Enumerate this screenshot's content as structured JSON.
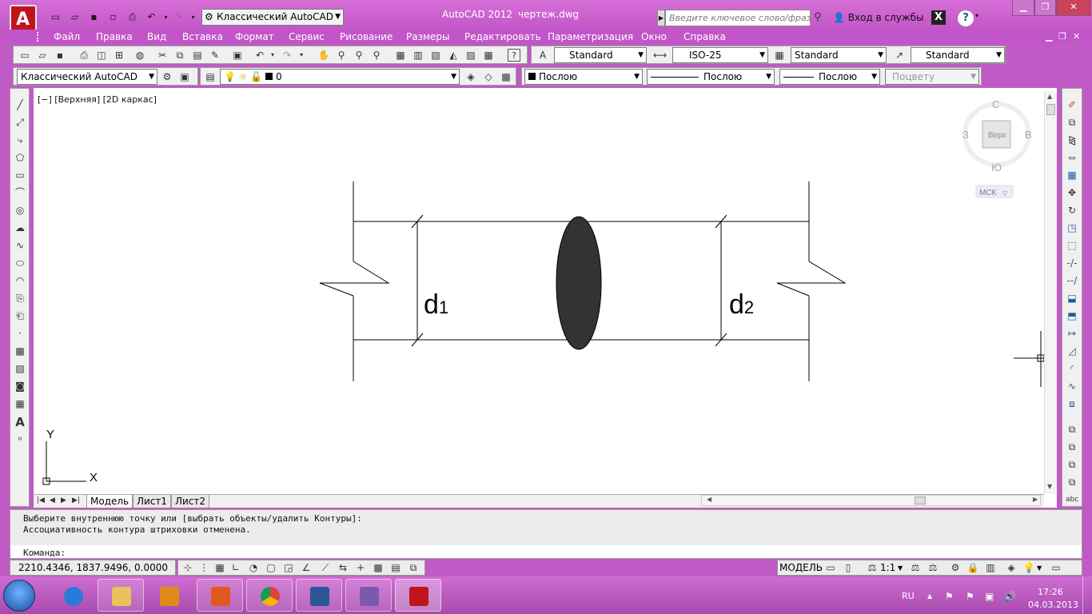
{
  "title_bar": {
    "workspace": "Классический AutoCAD",
    "app_name": "AutoCAD 2012",
    "document": "чертеж.dwg",
    "search_placeholder": "Введите ключевое слово/фразу",
    "sign_in": "Вход в службы"
  },
  "menu": [
    "Файл",
    "Правка",
    "Вид",
    "Вставка",
    "Формат",
    "Сервис",
    "Рисование",
    "Размеры",
    "Редактировать",
    "Параметризация",
    "Окно",
    "Справка"
  ],
  "styles_toolbar": {
    "text_style": "Standard",
    "dim_style": "ISO-25",
    "table_style": "Standard",
    "multileader_style": "Standard"
  },
  "properties_toolbar": {
    "workspace": "Классический AutoCAD",
    "layer": "0",
    "color": "Послою",
    "linetype": "Послою",
    "lineweight": "Послою",
    "plotstyle": "Поцвету"
  },
  "viewport": {
    "label": "[−] [Верхняя] [2D каркас]",
    "viewcube": {
      "north": "С",
      "south": "Ю",
      "west": "З",
      "east": "В",
      "face": "Верх",
      "ucs": "МСК"
    },
    "ucs_x": "X",
    "ucs_y": "Y"
  },
  "drawing": {
    "label_left_base": "d",
    "label_left_sub": "1",
    "label_right_base": "d",
    "label_right_sub": "2"
  },
  "tabs": [
    "Модель",
    "Лист1",
    "Лист2"
  ],
  "command": {
    "history": [
      "Выберите внутреннюю точку или [выбрать объекты/удалить Контуры]:",
      "Ассоциативность контура штриховки отменена."
    ],
    "prompt": "Команда:"
  },
  "status": {
    "coords": "2210.4346, 1837.9496, 0.0000",
    "space": "МОДЕЛЬ",
    "scale": "1:1"
  },
  "tray": {
    "language": "RU",
    "time": "17:26",
    "date": "04.03.2013"
  },
  "colors": {
    "accent": "#c257c8",
    "autocad_red": "#c0141c",
    "fill_ellipse": "#333333"
  }
}
